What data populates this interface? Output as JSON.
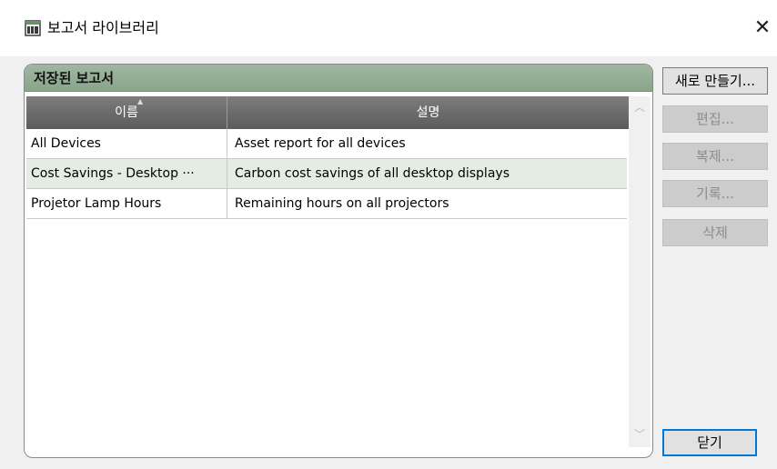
{
  "window": {
    "title": "보고서 라이브러리",
    "close_glyph": "✕"
  },
  "group": {
    "title": "저장된 보고서"
  },
  "table": {
    "columns": [
      "이름",
      "설명"
    ],
    "rows": [
      {
        "name": "All Devices",
        "description": "Asset report for all devices"
      },
      {
        "name": "Cost Savings - Desktop ···",
        "description": "Carbon cost savings of all desktop displays"
      },
      {
        "name": "Projetor Lamp Hours",
        "description": "Remaining hours on all projectors"
      }
    ],
    "selected_row": 1
  },
  "buttons": {
    "new": "새로 만들기...",
    "edit": "편집...",
    "copy": "복제...",
    "history": "기록...",
    "delete": "삭제",
    "close": "닫기"
  },
  "colors": {
    "group_header": "#8aa58b",
    "grid_header": "#5b5b5b",
    "selected_row": "#e4ede4",
    "default_button_border": "#0078d7"
  }
}
